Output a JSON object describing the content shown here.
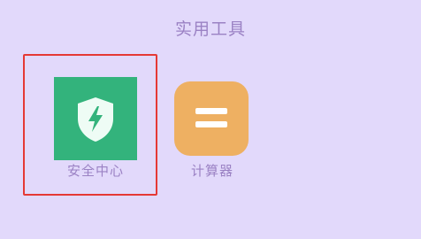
{
  "folder": {
    "title": "实用工具"
  },
  "apps": [
    {
      "label": "安全中心",
      "icon": "shield-bolt-icon",
      "icon_background": "#33b37c",
      "selected": true
    },
    {
      "label": "计算器",
      "icon": "equals-icon",
      "icon_background": "#eeb062",
      "selected": false
    }
  ],
  "colors": {
    "background": "#e2d9fb",
    "text": "#9b82c4",
    "selection_border": "#e53935"
  }
}
